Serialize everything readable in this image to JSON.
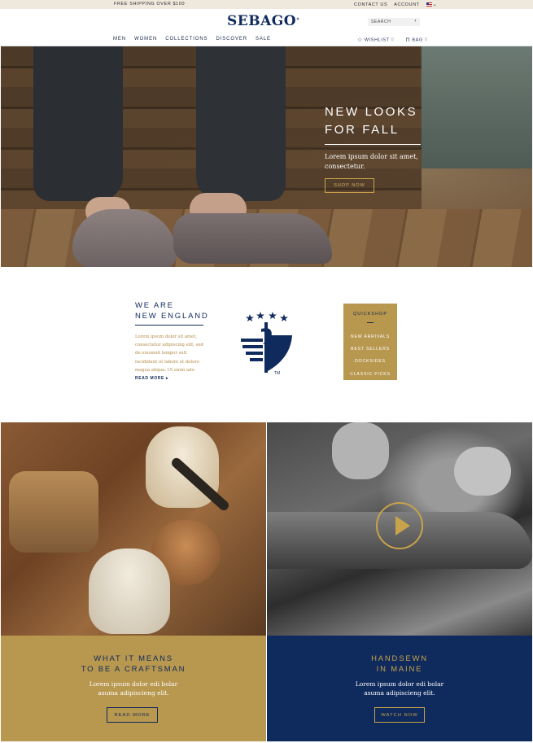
{
  "topbar": {
    "shipping": "FREE SHIPPING OVER $100",
    "contact": "CONTACT US",
    "account": "ACCOUNT"
  },
  "header": {
    "logo": "SEBAGO",
    "search_placeholder": "SEARCH",
    "nav": [
      "MEN",
      "WOMEN",
      "COLLECTIONS",
      "DISCOVER",
      "SALE"
    ],
    "wishlist": {
      "label": "WISHLIST",
      "count": "0"
    },
    "bag": {
      "label": "BAG",
      "count": "0"
    }
  },
  "hero": {
    "title_line1": "NEW LOOKS",
    "title_line2": "FOR FALL",
    "subtitle": "Lorem ipsum dolor sit amet, consectetur.",
    "button": "SHOP NOW"
  },
  "intro": {
    "title_line1": "WE ARE",
    "title_line2": "NEW ENGLAND",
    "body": "Lorem ipsum dolor sit amet, consectetur adipiscing elit, sed do eiusmod tempor sult incididunt ut labore et dolore magna aliqua. Ut enim ado.",
    "read_more": "READ MORE ▸"
  },
  "emblem": {
    "mark": "TM"
  },
  "quickshop": {
    "title": "QUICKSHOP",
    "items": [
      "NEW ARRIVALS",
      "BEST SELLERS",
      "DOCKSIDES",
      "CLASSIC PICKS"
    ]
  },
  "panels": [
    {
      "title_line1": "WHAT IT MEANS",
      "title_line2": "TO BE A CRAFTSMAN",
      "body_line1": "Lorem ipsum dolor edi bolar",
      "body_line2": "asuma adipiscieng elit.",
      "button": "READ MORE"
    },
    {
      "title_line1": "HANDSEWN",
      "title_line2": "IN MAINE",
      "body_line1": "Lorem ipsum dolor edi bolar",
      "body_line2": "asuma adipiscieng elit.",
      "button": "WATCH NOW"
    }
  ],
  "colors": {
    "navy": "#0f2a5c",
    "gold": "#b8974f",
    "topbar": "#efe9dd"
  }
}
